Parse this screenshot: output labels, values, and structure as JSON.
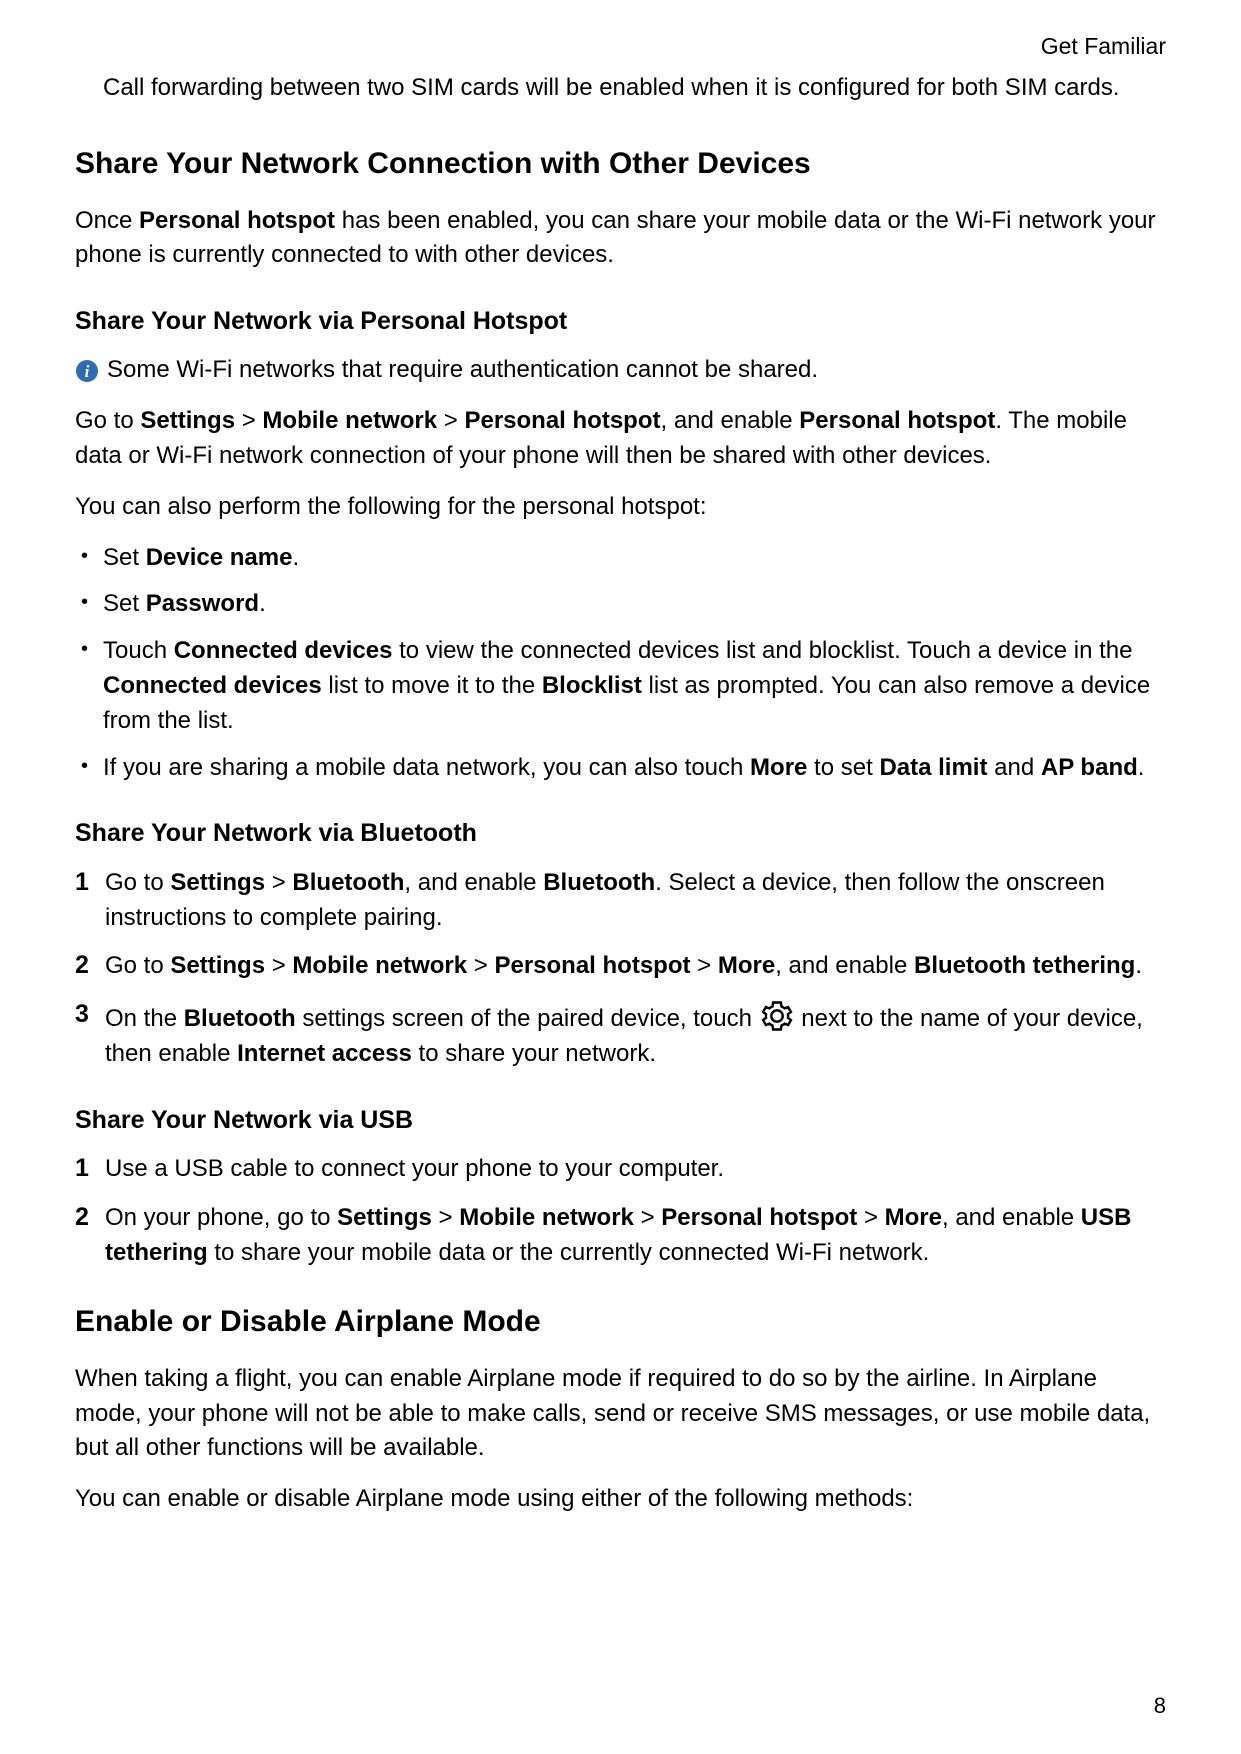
{
  "header": {
    "section_label": "Get Familiar"
  },
  "intro_continuation": "Call forwarding between two SIM cards will be enabled when it is configured for both SIM cards.",
  "share_section": {
    "heading": "Share Your Network Connection with Other Devices",
    "intro_before_bold": "Once ",
    "intro_bold": "Personal hotspot",
    "intro_after_bold": " has been enabled, you can share your mobile data or the Wi-Fi network your phone is currently connected to with other devices."
  },
  "hotspot_sub": {
    "heading": "Share Your Network via Personal Hotspot",
    "info_note": "Some Wi-Fi networks that require authentication cannot be shared.",
    "path_para": {
      "p1": "Go to ",
      "b1": "Settings",
      "s1": " > ",
      "b2": "Mobile network",
      "s2": " > ",
      "b3": "Personal hotspot",
      "s3": ", and enable ",
      "b4": "Personal hotspot",
      "s4": ". The mobile data or Wi-Fi network connection of your phone will then be shared with other devices."
    },
    "followup": "You can also perform the following for the personal hotspot:",
    "bullets": {
      "b1": {
        "pre": "Set ",
        "bold": "Device name",
        "post": "."
      },
      "b2": {
        "pre": "Set ",
        "bold": "Password",
        "post": "."
      },
      "b3": {
        "t1": "Touch ",
        "bd1": "Connected devices",
        "t2": " to view the connected devices list and blocklist. Touch a device in the ",
        "bd2": "Connected devices",
        "t3": " list to move it to the ",
        "bd3": "Blocklist",
        "t4": " list as prompted. You can also remove a device from the list."
      },
      "b4": {
        "t1": "If you are sharing a mobile data network, you can also touch ",
        "bd1": "More",
        "t2": " to set ",
        "bd2": "Data limit",
        "t3": " and ",
        "bd3": "AP band",
        "t4": "."
      }
    }
  },
  "bluetooth_sub": {
    "heading": "Share Your Network via Bluetooth",
    "steps": {
      "s1": {
        "t1": "Go to ",
        "bd1": "Settings",
        "t2": " > ",
        "bd2": "Bluetooth",
        "t3": ", and enable ",
        "bd3": "Bluetooth",
        "t4": ". Select a device, then follow the onscreen instructions to complete pairing."
      },
      "s2": {
        "t1": "Go to ",
        "bd1": "Settings",
        "t2": " > ",
        "bd2": "Mobile network",
        "t3": " > ",
        "bd3": "Personal hotspot",
        "t4": " > ",
        "bd4": "More",
        "t5": ", and enable ",
        "bd5": "Bluetooth tethering",
        "t6": "."
      },
      "s3": {
        "t1": "On the ",
        "bd1": "Bluetooth",
        "t2": " settings screen of the paired device, touch ",
        "t3": " next to the name of your device, then enable ",
        "bd2": "Internet access",
        "t4": " to share your network."
      }
    }
  },
  "usb_sub": {
    "heading": "Share Your Network via USB",
    "steps": {
      "s1": {
        "t1": "Use a USB cable to connect your phone to your computer."
      },
      "s2": {
        "t1": "On your phone, go to ",
        "bd1": "Settings",
        "t2": " > ",
        "bd2": "Mobile network",
        "t3": " > ",
        "bd3": "Personal hotspot",
        "t4": " > ",
        "bd4": "More",
        "t5": ", and enable ",
        "bd5": "USB tethering",
        "t6": " to share your mobile data or the currently connected Wi-Fi network."
      }
    }
  },
  "airplane_section": {
    "heading": "Enable or Disable Airplane Mode",
    "p1": "When taking a flight, you can enable Airplane mode if required to do so by the airline. In Airplane mode, your phone will not be able to make calls, send or receive SMS messages, or use mobile data, but all other functions will be available.",
    "p2": "You can enable or disable Airplane mode using either of the following methods:"
  },
  "page_number": "8"
}
